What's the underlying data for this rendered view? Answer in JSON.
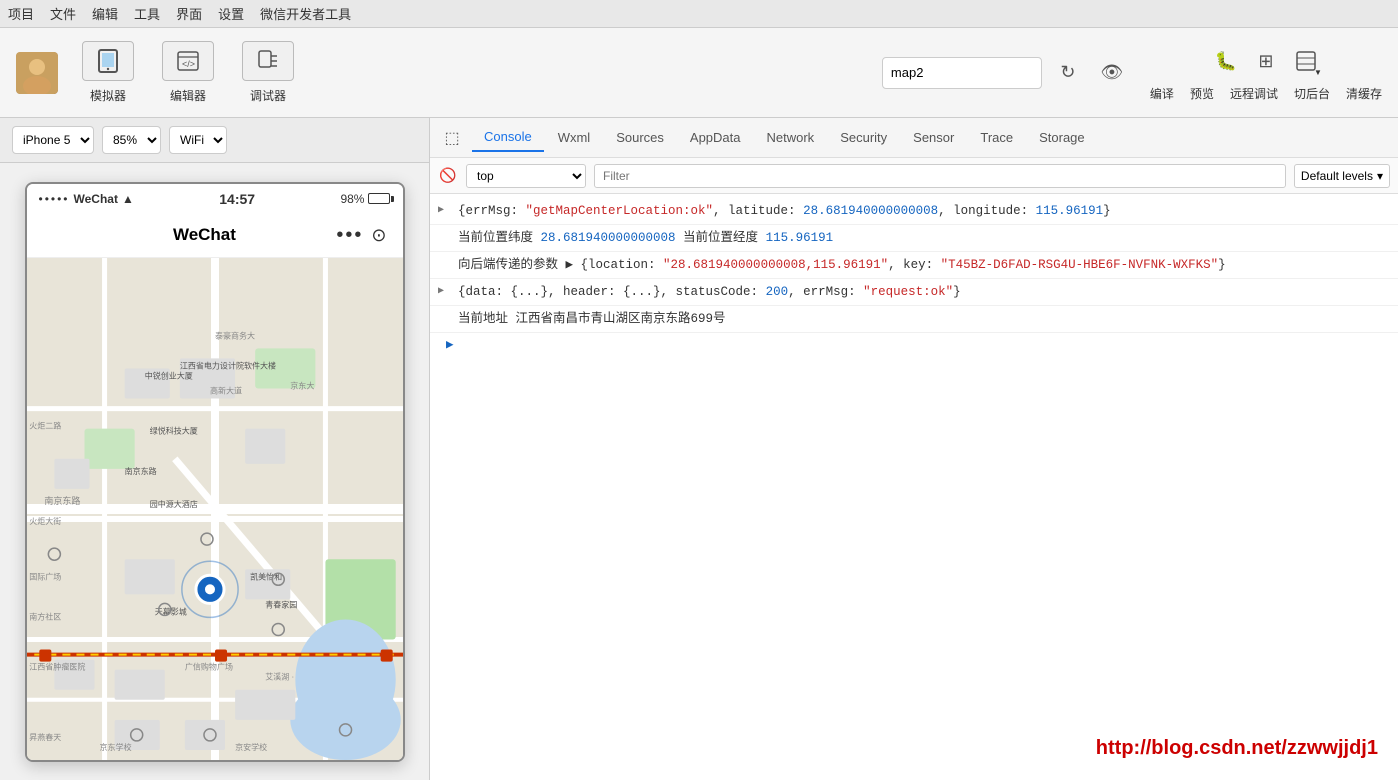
{
  "menubar": {
    "items": [
      "项目",
      "文件",
      "编辑",
      "工具",
      "界面",
      "设置",
      "微信开发者工具"
    ]
  },
  "toolbar": {
    "avatar_label": "👤",
    "simulator_label": "模拟器",
    "editor_label": "编辑器",
    "debugger_label": "调试器",
    "project_name": "map2",
    "compile_label": "编译",
    "preview_label": "预览",
    "remote_debug_label": "远程调试",
    "cut_back_label": "切后台",
    "clean_label": "清缓存"
  },
  "simulator": {
    "device": "iPhone 5",
    "zoom": "85%",
    "network": "WiFi",
    "status_dots": "•••••",
    "carrier": "WeChat",
    "wifi_icon": "📶",
    "time": "14:57",
    "battery_pct": "98%",
    "app_title": "WeChat"
  },
  "devtools": {
    "tabs": [
      {
        "id": "console",
        "label": "Console",
        "active": true
      },
      {
        "id": "wxml",
        "label": "Wxml",
        "active": false
      },
      {
        "id": "sources",
        "label": "Sources",
        "active": false
      },
      {
        "id": "appdata",
        "label": "AppData",
        "active": false
      },
      {
        "id": "network",
        "label": "Network",
        "active": false
      },
      {
        "id": "security",
        "label": "Security",
        "active": false
      },
      {
        "id": "sensor",
        "label": "Sensor",
        "active": false
      },
      {
        "id": "trace",
        "label": "Trace",
        "active": false
      },
      {
        "id": "storage",
        "label": "Storage",
        "active": false
      }
    ],
    "console": {
      "context": "top",
      "filter_placeholder": "Filter",
      "default_levels": "Default levels",
      "lines": [
        {
          "type": "object",
          "expandable": true,
          "parts": [
            {
              "text": "{errMsg: ",
              "color": "black"
            },
            {
              "text": "\"getMapCenterLocation:ok\"",
              "color": "red"
            },
            {
              "text": ", latitude: ",
              "color": "black"
            },
            {
              "text": "28.681940000000008",
              "color": "blue"
            },
            {
              "text": ", longitude: ",
              "color": "black"
            },
            {
              "text": "115.96191",
              "color": "blue"
            },
            {
              "text": "}",
              "color": "black"
            }
          ]
        },
        {
          "type": "text",
          "expandable": false,
          "parts": [
            {
              "text": "当前位置纬度 ",
              "color": "black"
            },
            {
              "text": "28.681940000000008",
              "color": "blue"
            },
            {
              "text": " 当前位置经度 ",
              "color": "black"
            },
            {
              "text": "115.96191",
              "color": "blue"
            }
          ]
        },
        {
          "type": "object",
          "expandable": true,
          "parts": [
            {
              "text": "向后端传递的参数 ",
              "color": "black"
            },
            {
              "text": "▶ {location: ",
              "color": "black"
            },
            {
              "text": "\"28.681940000000008,115.96191\"",
              "color": "red"
            },
            {
              "text": ", key: ",
              "color": "black"
            },
            {
              "text": "\"T45BZ-D6FAD-RSG4U-HBE6F-NVFNK-WXFKS\"",
              "color": "red"
            },
            {
              "text": "}",
              "color": "black"
            }
          ]
        },
        {
          "type": "object",
          "expandable": true,
          "parts": [
            {
              "text": "▶ {data: {...}, header: {...}, statusCode: ",
              "color": "black"
            },
            {
              "text": "200",
              "color": "blue"
            },
            {
              "text": ", errMsg: ",
              "color": "black"
            },
            {
              "text": "\"request:ok\"",
              "color": "red"
            },
            {
              "text": "}",
              "color": "black"
            }
          ]
        },
        {
          "type": "text",
          "expandable": false,
          "parts": [
            {
              "text": "当前地址 江西省南昌市青山湖区南京东路699号",
              "color": "black"
            }
          ]
        }
      ]
    }
  },
  "watermark": {
    "text": "http://blog.csdn.net/zzwwjjdj1"
  }
}
